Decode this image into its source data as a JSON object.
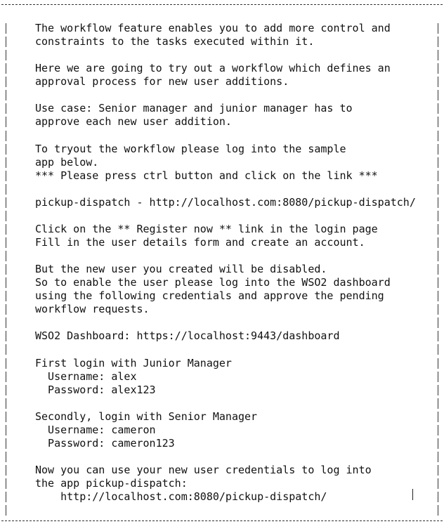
{
  "lines": [
    "The workflow feature enables you to add more control and",
    "constraints to the tasks executed within it.",
    "",
    "Here we are going to try out a workflow which defines an",
    "approval process for new user additions.",
    "",
    "Use case: Senior manager and junior manager has to",
    "approve each new user addition.",
    "",
    "To tryout the workflow please log into the sample",
    "app below.",
    "*** Please press ctrl button and click on the link ***",
    "",
    "pickup-dispatch - http://localhost.com:8080/pickup-dispatch/",
    "",
    "Click on the ** Register now ** link in the login page",
    "Fill in the user details form and create an account.",
    "",
    "But the new user you created will be disabled.",
    "So to enable the user please log into the WSO2 dashboard",
    "using the following credentials and approve the pending",
    "workflow requests.",
    "",
    "WSO2 Dashboard: https://localhost:9443/dashboard",
    "",
    "First login with Junior Manager",
    "  Username: alex",
    "  Password: alex123",
    "",
    "Secondly, login with Senior Manager",
    "  Username: cameron",
    "  Password: cameron123",
    "",
    "Now you can use your new user credentials to log into",
    "the app pickup-dispatch:",
    "    http://localhost.com:8080/pickup-dispatch/"
  ]
}
